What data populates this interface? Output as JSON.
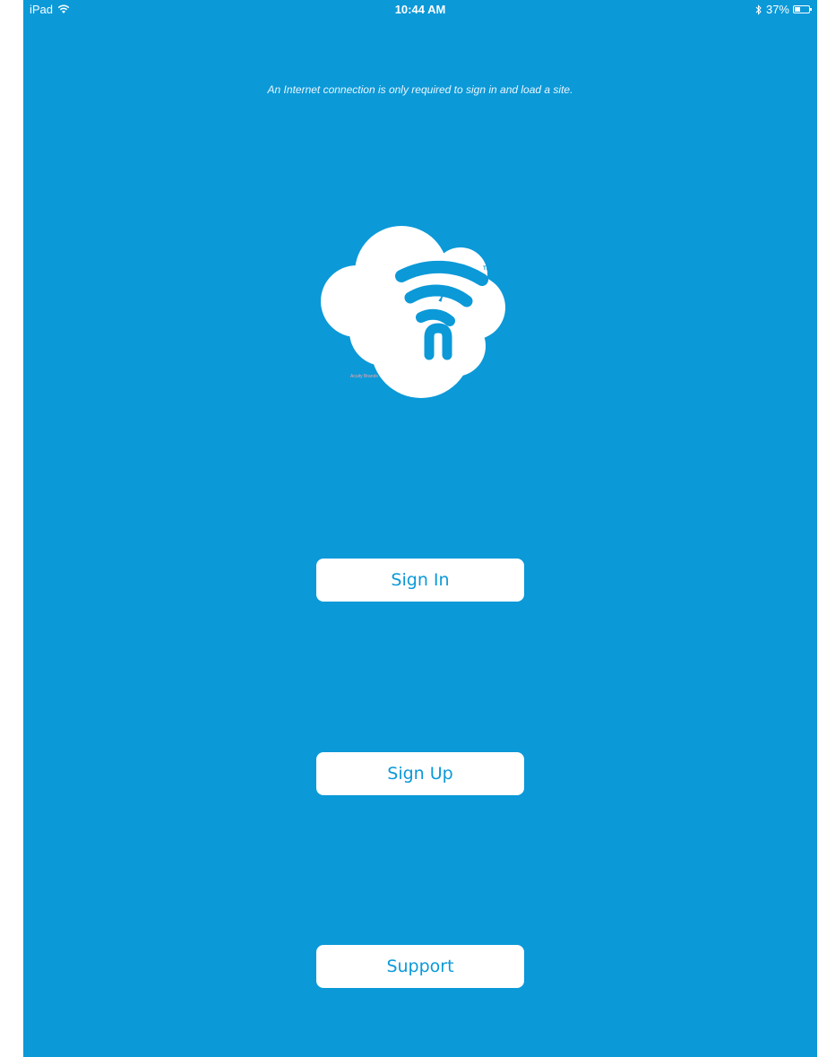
{
  "status_bar": {
    "device": "iPad",
    "time": "10:44 AM",
    "battery_percent": "37%",
    "battery_level": 0.37,
    "icons": [
      "wifi-icon",
      "bluetooth-icon",
      "battery-icon"
    ]
  },
  "notice": "An Internet connection is only required to sign in and load a site.",
  "logo": {
    "letter": "n",
    "trademark": "TM",
    "brand": "Acuity Brands",
    "icon": "cloud-wifi-logo"
  },
  "buttons": {
    "sign_in": "Sign In",
    "sign_up": "Sign Up",
    "support": "Support"
  },
  "colors": {
    "background": "#0b99d8",
    "button_bg": "#ffffff",
    "button_text": "#0b99d8"
  }
}
